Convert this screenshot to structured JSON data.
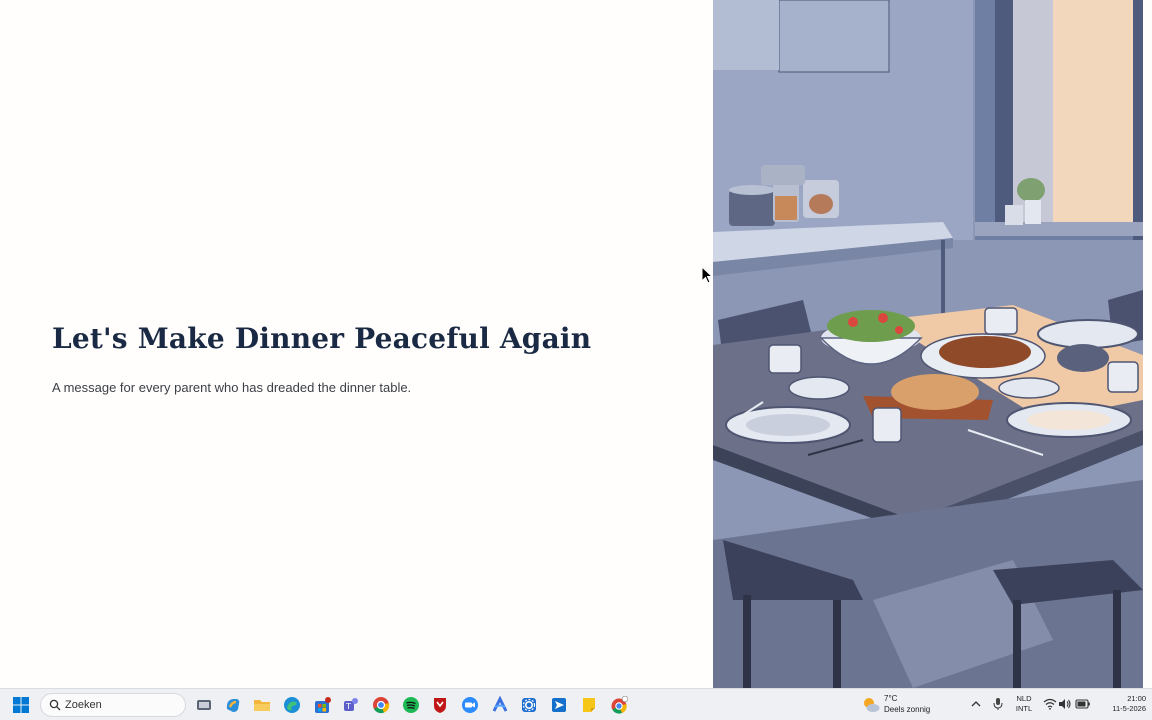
{
  "slide": {
    "title": "Let's Make Dinner Peaceful Again",
    "subtitle": "A message for every parent who has dreaded the dinner table."
  },
  "illustration": {
    "subject": "kitchen-dining-table-illustration"
  },
  "taskbar": {
    "search_placeholder": "Zoeken",
    "apps": [
      "task-view-icon",
      "copilot-icon",
      "file-explorer-icon",
      "edge-icon",
      "microsoft-store-icon",
      "teams-icon",
      "chrome-icon",
      "spotify-icon",
      "mcafee-icon",
      "zoom-icon",
      "arc-icon",
      "settings-icon",
      "send-app-icon",
      "sticky-notes-icon",
      "chrome-profile-icon"
    ],
    "weather": {
      "temp": "7°C",
      "desc": "Deels zonnig"
    },
    "language": {
      "line1": "NLD",
      "line2": "INTL"
    },
    "clock": {
      "time": "21:00",
      "date": "11-5-2026"
    }
  },
  "colors": {
    "title": "#1b2a44",
    "text": "#3b3f47",
    "taskbar_bg": "#eef0f4",
    "accent": "#0078d4"
  }
}
